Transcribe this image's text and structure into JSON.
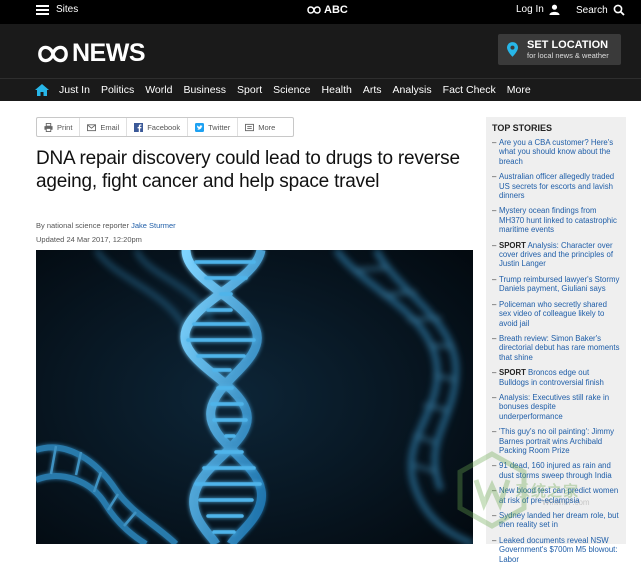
{
  "utility_bar": {
    "sites_label": "Sites",
    "abc_label": "ABC",
    "login_label": "Log In",
    "search_label": "Search"
  },
  "header": {
    "logo_text": "NEWS",
    "set_location_title": "SET LOCATION",
    "set_location_sub": "for local news & weather"
  },
  "nav": {
    "items": [
      "Just In",
      "Politics",
      "World",
      "Business",
      "Sport",
      "Science",
      "Health",
      "Arts",
      "Analysis",
      "Fact Check",
      "More"
    ]
  },
  "share": {
    "print": "Print",
    "email": "Email",
    "facebook": "Facebook",
    "twitter": "Twitter",
    "more": "More"
  },
  "article": {
    "headline": "DNA repair discovery could lead to drugs to reverse ageing, fight cancer and help space travel",
    "byline_prefix": "By national science reporter",
    "author": "Jake Sturmer",
    "updated": "Updated 24 Mar 2017, 12:20pm"
  },
  "sidebar": {
    "title": "TOP STORIES",
    "items": [
      {
        "tag": "",
        "text": "Are you a CBA customer? Here's what you should know about the breach"
      },
      {
        "tag": "",
        "text": "Australian officer allegedly traded US secrets for escorts and lavish dinners"
      },
      {
        "tag": "",
        "text": "Mystery ocean findings from MH370 hunt linked to catastrophic maritime events"
      },
      {
        "tag": "SPORT",
        "text": "Analysis: Character over cover drives and the principles of Justin Langer"
      },
      {
        "tag": "",
        "text": "Trump reimbursed lawyer's Stormy Daniels payment, Giuliani says"
      },
      {
        "tag": "",
        "text": "Policeman who secretly shared sex video of colleague likely to avoid jail"
      },
      {
        "tag": "",
        "text": "Breath review: Simon Baker's directorial debut has rare moments that shine"
      },
      {
        "tag": "SPORT",
        "text": "Broncos edge out Bulldogs in controversial finish"
      },
      {
        "tag": "",
        "text": "Analysis: Executives still rake in bonuses despite underperformance"
      },
      {
        "tag": "",
        "text": "'This guy's no oil painting': Jimmy Barnes portrait wins Archibald Packing Room Prize"
      },
      {
        "tag": "",
        "text": "91 dead, 160 injured as rain and dust storms sweep through India"
      },
      {
        "tag": "",
        "text": "New blood test can predict women at risk of pre-eclampsia"
      },
      {
        "tag": "",
        "text": "Sydney landed her dream role, but then reality set in"
      },
      {
        "tag": "",
        "text": "Leaked documents reveal NSW Government's $700m M5 blowout: Labor"
      }
    ]
  },
  "watermark": {
    "text": "系统之家",
    "url": "Winwin7.com"
  }
}
